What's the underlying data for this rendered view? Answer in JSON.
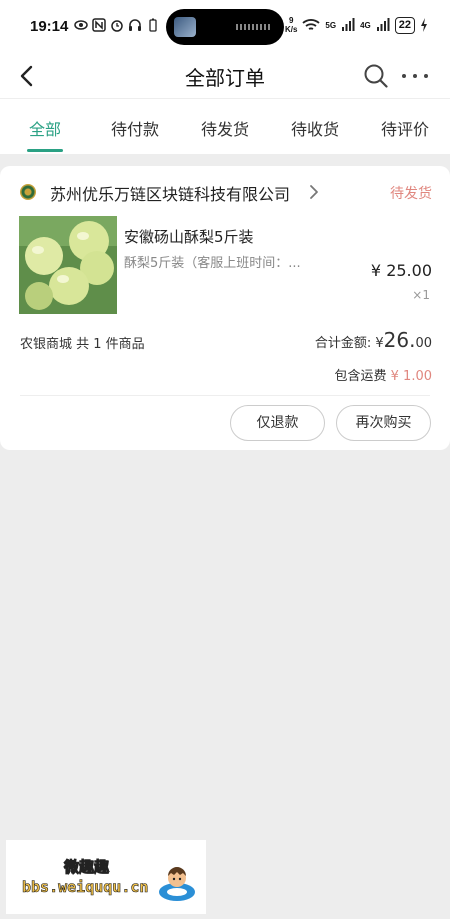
{
  "status_bar": {
    "time": "19:14",
    "speed_top": "9",
    "speed_unit": "K/s",
    "net1": "5G",
    "net2": "4G",
    "battery": "22"
  },
  "header": {
    "title": "全部订单",
    "back_icon": "back-arrow-icon",
    "search_icon": "search-icon",
    "more_icon": "more-dots-icon"
  },
  "tabs": [
    {
      "label": "全部",
      "active": true
    },
    {
      "label": "待付款",
      "active": false
    },
    {
      "label": "待发货",
      "active": false
    },
    {
      "label": "待收货",
      "active": false
    },
    {
      "label": "待评价",
      "active": false
    }
  ],
  "order": {
    "shop_name": "苏州优乐万链区块链科技有限公司",
    "status": "待发货",
    "product": {
      "name": "安徽砀山酥梨5斤装",
      "spec": "酥梨5斤装（客服上班时间：...",
      "price": "¥ 25.00",
      "quantity": "×1"
    },
    "store_summary": "农银商城 共 1 件商品",
    "total_label": "合计金额: ¥",
    "total_int": "26.",
    "total_dec": "00",
    "shipping_label": "包含运费",
    "shipping_fee": "¥ 1.00",
    "buttons": {
      "refund": "仅退款",
      "rebuy": "再次购买"
    }
  },
  "colors": {
    "accent": "#2aa184",
    "status": "#e0877f",
    "background": "#ededed"
  },
  "watermark": {
    "title": "微趣趣",
    "url": "bbs.weiququ.cn"
  }
}
